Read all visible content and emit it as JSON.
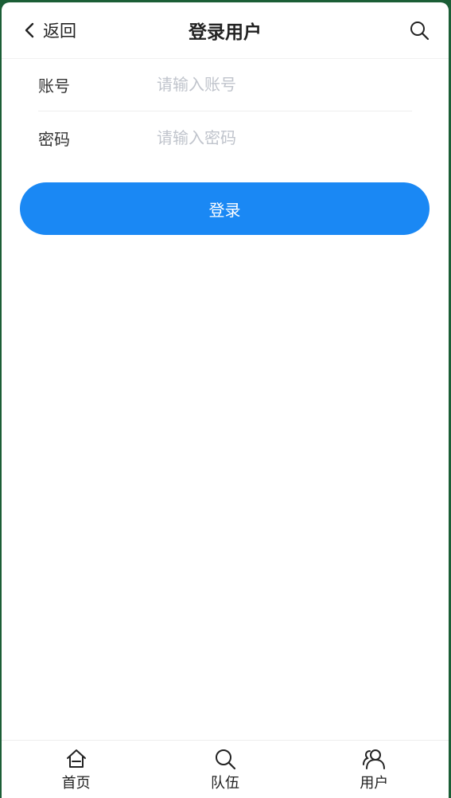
{
  "navbar": {
    "back_label": "返回",
    "title": "登录用户",
    "back_icon": "chevron-left-icon",
    "search_icon": "search-icon"
  },
  "form": {
    "account": {
      "label": "账号",
      "placeholder": "请输入账号",
      "value": ""
    },
    "password": {
      "label": "密码",
      "placeholder": "请输入密码",
      "value": ""
    }
  },
  "login_button": {
    "label": "登录"
  },
  "tabbar": {
    "items": [
      {
        "label": "首页",
        "icon": "home-icon"
      },
      {
        "label": "队伍",
        "icon": "search-icon"
      },
      {
        "label": "用户",
        "icon": "users-icon"
      }
    ]
  },
  "colors": {
    "accent": "#1a88f4",
    "frame_background": "#1b5e36",
    "placeholder": "#c0c4cc"
  }
}
